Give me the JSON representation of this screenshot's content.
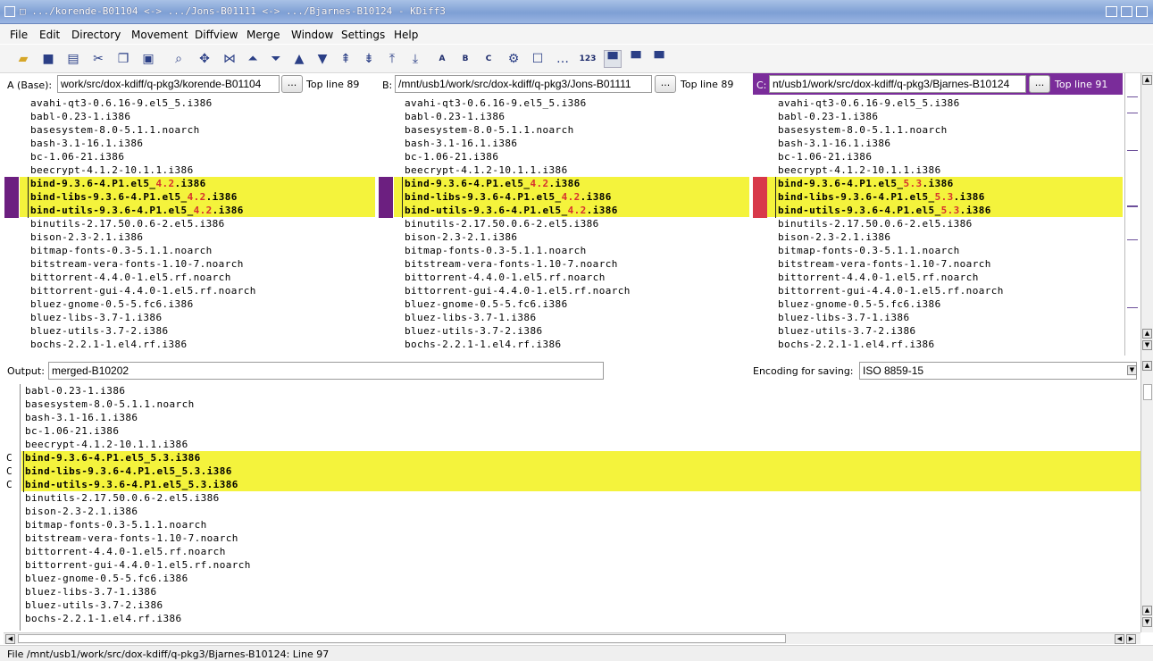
{
  "window": {
    "title": "□ .../korende-B01104 <-> .../Jons-B01111 <-> .../Bjarnes-B10124 - KDiff3"
  },
  "menu": [
    "File",
    "Edit",
    "Directory",
    "Movement",
    "Diffview",
    "Merge",
    "Window",
    "Settings",
    "Help"
  ],
  "toolbar": {
    "text_tools": [
      "A",
      "B",
      "C",
      "123"
    ]
  },
  "panes": {
    "a": {
      "label": "A (Base):",
      "path": "work/src/dox-kdiff/q-pkg3/korende-B01104",
      "browse": "...",
      "top_line": "Top line 89"
    },
    "b": {
      "label": "B:",
      "path": "/mnt/usb1/work/src/dox-kdiff/q-pkg3/Jons-B01111",
      "browse": "...",
      "top_line": "Top line 89"
    },
    "c": {
      "label": "C:",
      "path": "nt/usb1/work/src/dox-kdiff/q-pkg3/Bjarnes-B10124",
      "browse": "...",
      "top_line": "Top line 91"
    }
  },
  "lines_a": [
    "avahi-qt3-0.6.16-9.el5_5.i386",
    "babl-0.23-1.i386",
    "basesystem-8.0-5.1.1.noarch",
    "bash-3.1-16.1.i386",
    "bc-1.06-21.i386",
    "beecrypt-4.1.2-10.1.1.i386",
    "bind-9.3.6-4.P1.el5_4.2.i386",
    "bind-libs-9.3.6-4.P1.el5_4.2.i386",
    "bind-utils-9.3.6-4.P1.el5_4.2.i386",
    "binutils-2.17.50.0.6-2.el5.i386",
    "bison-2.3-2.1.i386",
    "bitmap-fonts-0.3-5.1.1.noarch",
    "bitstream-vera-fonts-1.10-7.noarch",
    "bittorrent-4.4.0-1.el5.rf.noarch",
    "bittorrent-gui-4.4.0-1.el5.rf.noarch",
    "bluez-gnome-0.5-5.fc6.i386",
    "bluez-libs-3.7-1.i386",
    "bluez-utils-3.7-2.i386",
    "bochs-2.2.1-1.el4.rf.i386"
  ],
  "lines_c_diff": [
    "bind-9.3.6-4.P1.el5_5.3.i386",
    "bind-libs-9.3.6-4.P1.el5_5.3.i386",
    "bind-utils-9.3.6-4.P1.el5_5.3.i386"
  ],
  "output": {
    "label": "Output:",
    "name": "merged-B10202",
    "encoding_label": "Encoding for saving:",
    "encoding": "ISO 8859-15",
    "conflict_mark": "C",
    "lines": [
      "babl-0.23-1.i386",
      "basesystem-8.0-5.1.1.noarch",
      "bash-3.1-16.1.i386",
      "bc-1.06-21.i386",
      "beecrypt-4.1.2-10.1.1.i386",
      "bind-9.3.6-4.P1.el5_5.3.i386",
      "bind-libs-9.3.6-4.P1.el5_5.3.i386",
      "bind-utils-9.3.6-4.P1.el5_5.3.i386",
      "binutils-2.17.50.0.6-2.el5.i386",
      "bison-2.3-2.1.i386",
      "bitmap-fonts-0.3-5.1.1.noarch",
      "bitstream-vera-fonts-1.10-7.noarch",
      "bittorrent-4.4.0-1.el5.rf.noarch",
      "bittorrent-gui-4.4.0-1.el5.rf.noarch",
      "bluez-gnome-0.5-5.fc6.i386",
      "bluez-libs-3.7-1.i386",
      "bluez-utils-3.7-2.i386",
      "bochs-2.2.1-1.el4.rf.i386"
    ]
  },
  "status": "File /mnt/usb1/work/src/dox-kdiff/q-pkg3/Bjarnes-B10124: Line 97",
  "colors": {
    "highlight": "#f4f33c",
    "marker_ab": "#6c1f80",
    "marker_c": "#d8394a",
    "c_header": "#7a2c9a",
    "diff_text": "#d6322e"
  }
}
